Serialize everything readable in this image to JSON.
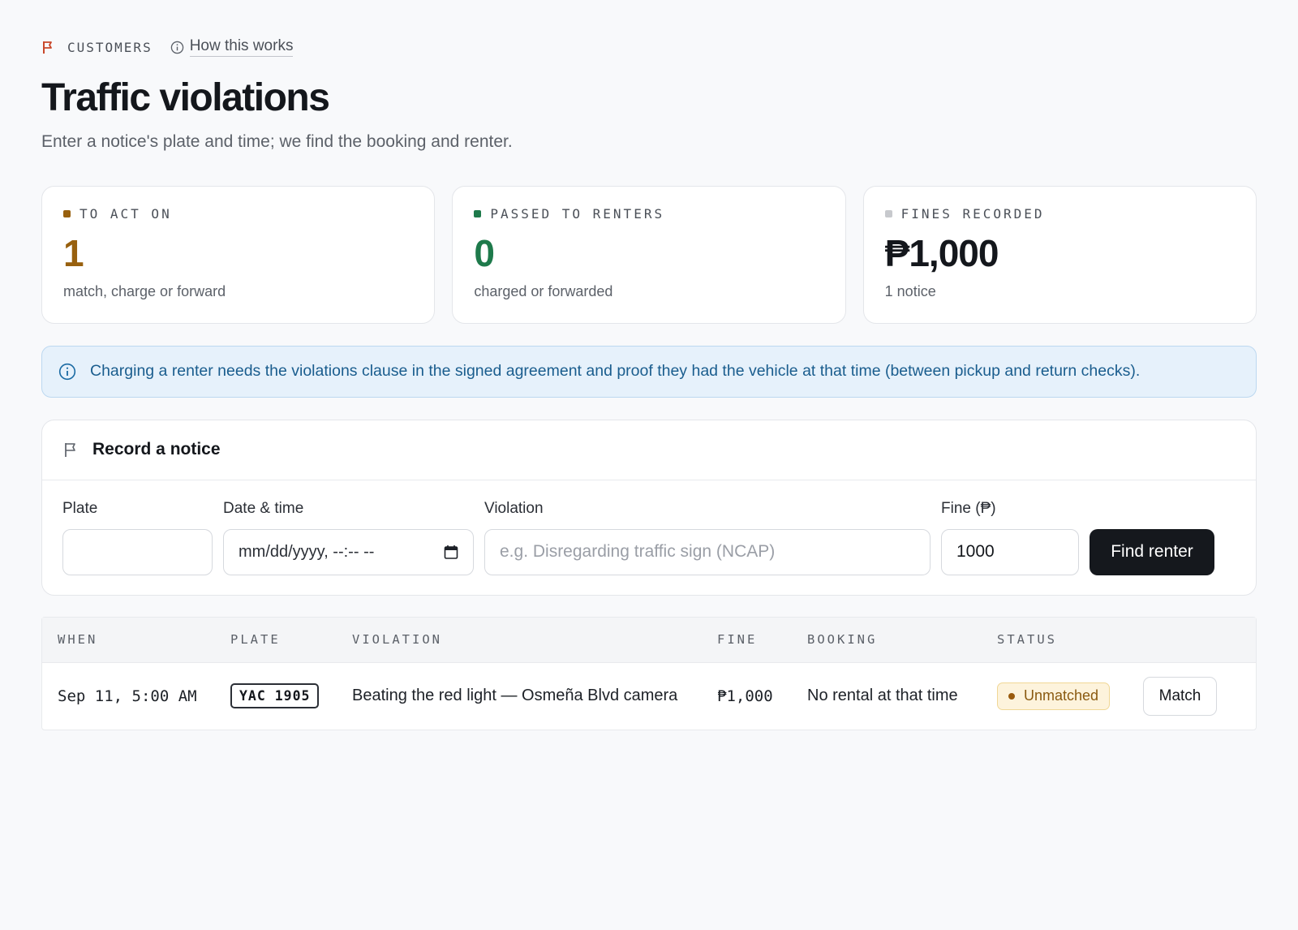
{
  "header": {
    "eyebrow": "CUSTOMERS",
    "how_link": "How this works",
    "title": "Traffic violations",
    "subtitle": "Enter a notice's plate and time; we find the booking and renter."
  },
  "stats": [
    {
      "label": "TO ACT ON",
      "value": "1",
      "sub": "match, charge or forward",
      "color": "#98600e",
      "dot": "#98600e"
    },
    {
      "label": "PASSED TO RENTERS",
      "value": "0",
      "sub": "charged or forwarded",
      "color": "#1e7a4b",
      "dot": "#1e7a4b"
    },
    {
      "label": "FINES RECORDED",
      "value": "₱1,000",
      "sub": "1 notice",
      "color": "#14171c",
      "dot": "#c7c9cd"
    }
  ],
  "banner": {
    "text": "Charging a renter needs the violations clause in the signed agreement and proof they had the vehicle at that time (between pickup and return checks)."
  },
  "record": {
    "title": "Record a notice",
    "plate_label": "Plate",
    "plate_value": "",
    "datetime_label": "Date & time",
    "datetime_placeholder": "mm/dd/yyyy, --:-- --",
    "violation_label": "Violation",
    "violation_placeholder": "e.g. Disregarding traffic sign (NCAP)",
    "fine_label": "Fine (₱)",
    "fine_value": "1000",
    "submit": "Find renter"
  },
  "table": {
    "columns": [
      "WHEN",
      "PLATE",
      "VIOLATION",
      "FINE",
      "BOOKING",
      "STATUS"
    ],
    "rows": [
      {
        "when": "Sep 11, 5:00 AM",
        "plate": "YAC 1905",
        "violation": "Beating the red light — Osmeña Blvd camera",
        "fine": "₱1,000",
        "booking": "No rental at that time",
        "status": "Unmatched",
        "action": "Match"
      }
    ]
  },
  "colors": {
    "accent_flag": "#c9482b",
    "banner_text": "#1a5d8e",
    "status_warning": "#8a5a10"
  }
}
